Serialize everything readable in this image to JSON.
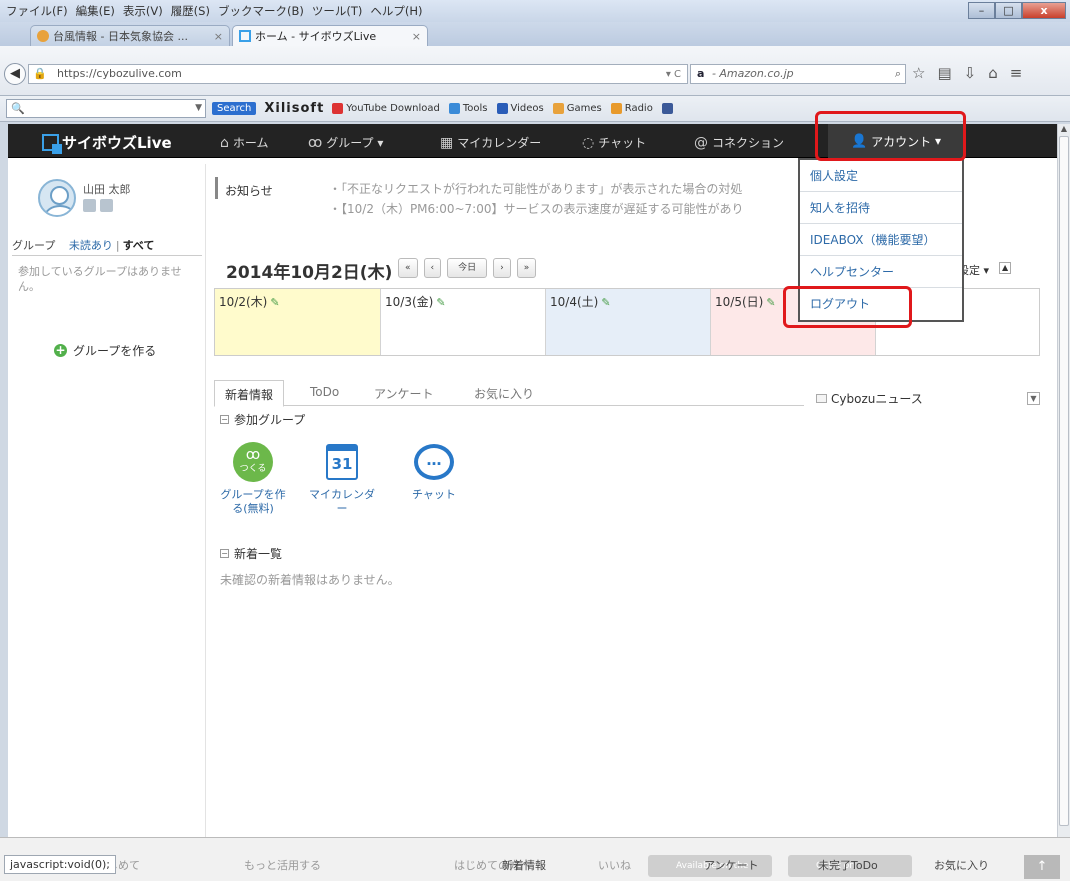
{
  "browser": {
    "menu": [
      "ファイル(F)",
      "編集(E)",
      "表示(V)",
      "履歴(S)",
      "ブックマーク(B)",
      "ツール(T)",
      "ヘルプ(H)"
    ],
    "window_buttons": {
      "min": "–",
      "max": "□",
      "close": "x"
    },
    "tabs": [
      {
        "label": "台風情報 - 日本気象協会 ...",
        "active": false
      },
      {
        "label": "ホーム - サイボウズLive",
        "active": true
      }
    ],
    "new_tab": "+",
    "url": "https://cybozulive.com",
    "search_engine_label": "a",
    "search_placeholder": "- Amazon.co.jp",
    "bookmarks": {
      "search_button": "Search",
      "brand": "Xilisoft",
      "items": [
        "YouTube Download",
        "Tools",
        "Videos",
        "Games",
        "Radio"
      ]
    }
  },
  "app": {
    "logo": "サイボウズLive",
    "nav": [
      "ホーム",
      "グループ",
      "マイカレンダー",
      "チャット",
      "コネクション"
    ],
    "account": "アカウント",
    "account_menu": [
      "個人設定",
      "知人を招待",
      "IDEABOX（機能要望）",
      "ヘルプセンター",
      "ログアウト"
    ],
    "user": {
      "name": "山田 太郎"
    },
    "group_filter": {
      "label": "グループ",
      "unread": "未読あり",
      "all": "すべて"
    },
    "no_groups": "参加しているグループはありません。",
    "create_group": "グループを作る",
    "notice": {
      "label": "お知らせ",
      "items": [
        "・「不正なリクエストが行われた可能性があります」が表示された場合の対処",
        "・【10/2（木）PM6:00~7:00】サービスの表示速度が遅延する可能性があり"
      ]
    },
    "calendar": {
      "date_title": "2014年10月2日(木)",
      "buttons": [
        "«",
        "‹",
        "今日",
        "›",
        "»"
      ],
      "settings": "設定",
      "days": [
        {
          "label": "10/2(木)",
          "bg": "#fffbcc"
        },
        {
          "label": "10/3(金)",
          "bg": "#ffffff"
        },
        {
          "label": "10/4(土)",
          "bg": "#e6eef8"
        },
        {
          "label": "10/5(日)",
          "bg": "#fde8e8"
        },
        {
          "label": "",
          "bg": "#ffffff"
        }
      ]
    },
    "content_tabs": [
      "新着情報",
      "ToDo",
      "アンケート",
      "お気に入り"
    ],
    "sections": {
      "participating": "参加グループ",
      "news": "新着一覧"
    },
    "apps": [
      {
        "label": "グループを作る(無料)",
        "badge": "つくる"
      },
      {
        "label": "マイカレンダー",
        "badge": "31"
      },
      {
        "label": "チャット",
        "badge": ""
      }
    ],
    "no_news": "未確認の新着情報はありません。",
    "cybozu_news": "Cybozuニュース"
  },
  "status": {
    "text": "javascript:void(0);",
    "bottom_links": [
      "はじめて",
      "もっと活用する",
      "はじめての方へ",
      "新着情報",
      "いいね",
      "アンケート",
      "未完了ToDo",
      "お気に入り"
    ],
    "badges": [
      "Available on the",
      "Get it on"
    ]
  },
  "colors": {
    "highlight": "#e0181b",
    "accent": "#2d6aa8"
  }
}
